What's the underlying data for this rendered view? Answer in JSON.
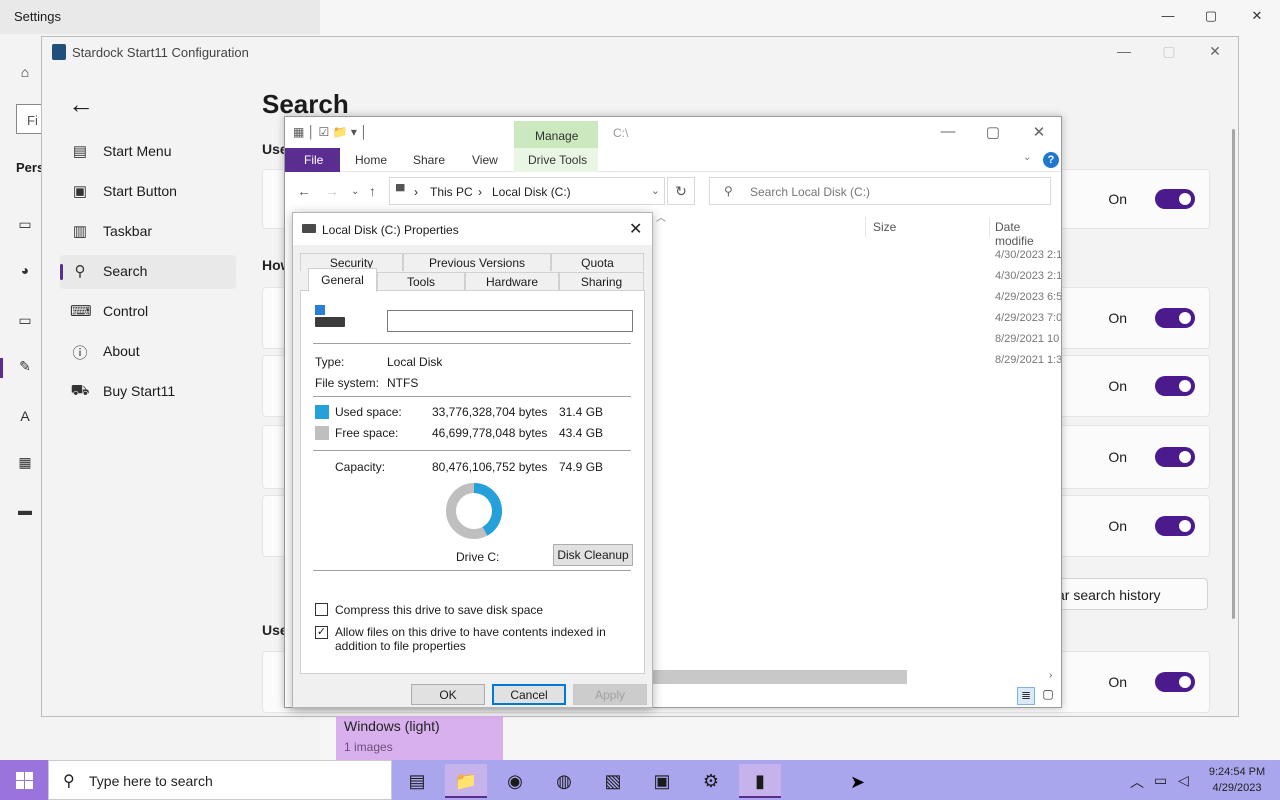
{
  "settings": {
    "title": "Settings",
    "search_stub": "Fi",
    "section_stub": "Pers",
    "controls": {
      "minimize": "—",
      "maximize": "▢",
      "close": "✕"
    }
  },
  "start11": {
    "title": "Stardock Start11 Configuration",
    "heading": "Search",
    "nav": [
      {
        "label": "Start Menu",
        "icon": "start-menu-icon"
      },
      {
        "label": "Start Button",
        "icon": "start-button-icon"
      },
      {
        "label": "Taskbar",
        "icon": "taskbar-icon"
      },
      {
        "label": "Search",
        "icon": "search-icon",
        "active": true
      },
      {
        "label": "Control",
        "icon": "keyboard-icon"
      },
      {
        "label": "About",
        "icon": "info-icon"
      },
      {
        "label": "Buy Start11",
        "icon": "cart-icon"
      }
    ],
    "sections": [
      "Use",
      "How",
      "Use"
    ],
    "toggle_label": "On",
    "clear_button": "ar search history",
    "accent": "#4b1a8c"
  },
  "explorer": {
    "manage_tab": "Manage",
    "path_title": "C:\\",
    "ribbon_tabs": [
      "File",
      "Home",
      "Share",
      "View",
      "Drive Tools"
    ],
    "breadcrumbs": [
      "This PC",
      "Local Disk (C:)"
    ],
    "search_placeholder": "Search Local Disk (C:)",
    "columns": {
      "size": "Size",
      "date": "Date modifie"
    },
    "dates": [
      "4/30/2023 2:1",
      "4/30/2023 2:1",
      "4/29/2023 6:5",
      "4/29/2023 7:0",
      "8/29/2021 10",
      "8/29/2021 1:3"
    ]
  },
  "dialog": {
    "title": "Local Disk (C:) Properties",
    "tabs_back": [
      "Security",
      "Previous Versions",
      "Quota"
    ],
    "tabs_front": [
      "General",
      "Tools",
      "Hardware",
      "Sharing"
    ],
    "type_label": "Type:",
    "type_value": "Local Disk",
    "fs_label": "File system:",
    "fs_value": "NTFS",
    "used_label": "Used space:",
    "used_bytes": "33,776,328,704 bytes",
    "used_gb": "31.4 GB",
    "free_label": "Free space:",
    "free_bytes": "46,699,778,048 bytes",
    "free_gb": "43.4 GB",
    "capacity_label": "Capacity:",
    "capacity_bytes": "80,476,106,752 bytes",
    "capacity_gb": "74.9 GB",
    "used_fraction": 0.42,
    "used_color": "#26a0da",
    "free_color": "#bfbfbf",
    "drive_label": "Drive C:",
    "cleanup_button": "Disk Cleanup",
    "compress_label": "Compress this drive to save disk space",
    "compress_checked": false,
    "index_label": "Allow files on this drive to have contents indexed in addition to file properties",
    "index_checked": true,
    "ok": "OK",
    "cancel": "Cancel",
    "apply": "Apply"
  },
  "gallery_tile": {
    "title": "Windows (light)",
    "count": "1 images"
  },
  "taskbar": {
    "search_placeholder": "Type here to search",
    "time": "9:24:54 PM",
    "date": "4/29/2023",
    "accent": "#a9a6ee"
  }
}
